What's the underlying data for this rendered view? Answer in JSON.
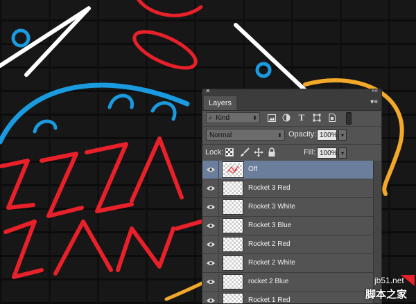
{
  "canvas": {
    "artwork": "neon pizza sign on brick wall",
    "colors": {
      "red": "#e8202a",
      "blue": "#1a9be0",
      "orange": "#f2a92a",
      "white": "#ffffff"
    }
  },
  "panel": {
    "close_icon": "close-icon",
    "collapse_icon": "double-chevron-icon",
    "tab_label": "Layers",
    "menu_icon": "panel-menu-icon",
    "filter": {
      "kind_label": "Kind",
      "icons": [
        "pixel-filter-icon",
        "adjustment-filter-icon",
        "type-filter-icon",
        "shape-filter-icon",
        "smart-object-filter-icon"
      ]
    },
    "blend": {
      "mode": "Normal",
      "opacity_label": "Opacity:",
      "opacity_value": "100%"
    },
    "lock": {
      "label": "Lock:",
      "icons": [
        "lock-transparent-icon",
        "lock-image-icon",
        "lock-position-icon",
        "lock-all-icon"
      ],
      "fill_label": "Fill:",
      "fill_value": "100%"
    },
    "layers": [
      {
        "name": "Off",
        "selected": true,
        "visible": true
      },
      {
        "name": "Rocket 3 Red",
        "selected": false,
        "visible": true
      },
      {
        "name": "Rocket 3 White",
        "selected": false,
        "visible": true
      },
      {
        "name": "Rocket 3 Blue",
        "selected": false,
        "visible": true
      },
      {
        "name": "Rocket 2 Red",
        "selected": false,
        "visible": true
      },
      {
        "name": "Rocket 2 White",
        "selected": false,
        "visible": true
      },
      {
        "name": "rocket 2 Blue",
        "selected": false,
        "visible": true
      },
      {
        "name": "Rocket 1 Red",
        "selected": false,
        "visible": true
      }
    ],
    "selection_color": "#6b7e9c"
  },
  "watermark": {
    "url": "jb51.net",
    "site_name": "脚本之家"
  }
}
